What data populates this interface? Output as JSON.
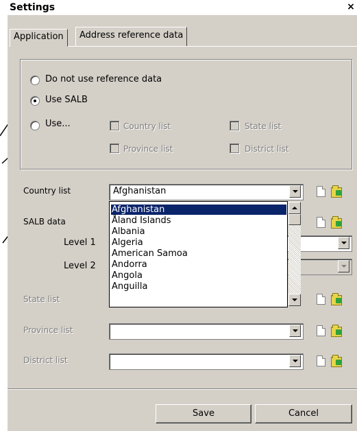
{
  "window": {
    "title": "Settings",
    "close_glyph": "×"
  },
  "tabs": [
    {
      "label": "Application",
      "active": false
    },
    {
      "label": "Address reference data",
      "active": true
    }
  ],
  "reference_mode": {
    "options": [
      {
        "label": "Do not use reference data",
        "checked": false
      },
      {
        "label": "Use SALB",
        "checked": true
      },
      {
        "label": "Use...",
        "checked": false
      }
    ],
    "checkboxes": [
      {
        "label": "Country list",
        "checked": false,
        "enabled": false
      },
      {
        "label": "State list",
        "checked": false,
        "enabled": false
      },
      {
        "label": "Province list",
        "checked": false,
        "enabled": false
      },
      {
        "label": "District list",
        "checked": false,
        "enabled": false
      }
    ]
  },
  "form": {
    "country_label": "Country list",
    "country_value": "Afghanistan",
    "salb_label": "SALB data",
    "level1_label": "Level 1",
    "level2_label": "Level 2",
    "state_label": "State list",
    "province_label": "Province list",
    "district_label": "District list"
  },
  "country_dropdown": {
    "options": [
      "Afghanistan",
      "Åland Islands",
      "Albania",
      "Algeria",
      "American Samoa",
      "Andorra",
      "Angola",
      "Anguilla"
    ],
    "selected": "Afghanistan"
  },
  "buttons": {
    "save": "Save",
    "cancel": "Cancel"
  },
  "icons": [
    "new-document-icon",
    "open-folder-icon",
    "chevron-down-icon",
    "chevron-up-icon",
    "close-icon"
  ],
  "colors": {
    "selection": "#0a246a",
    "dialog": "#d4d0c8"
  }
}
